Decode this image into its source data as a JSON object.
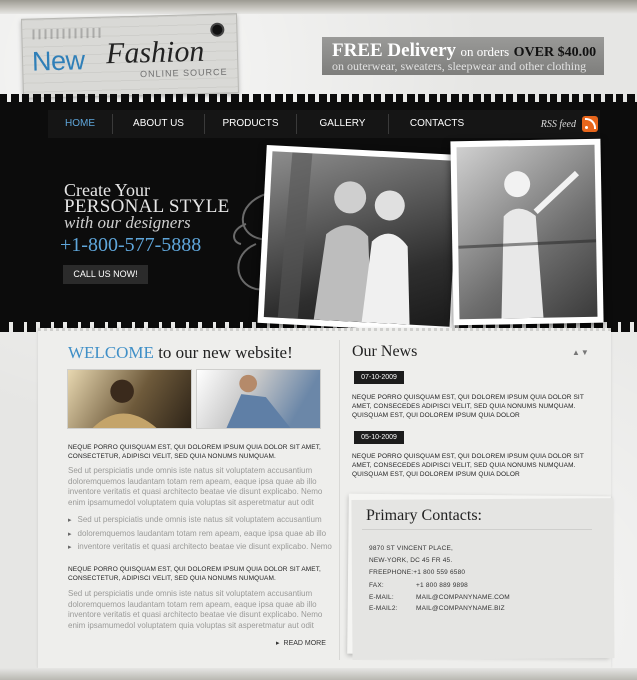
{
  "logo": {
    "word1": "New",
    "word2": "Fashion",
    "subtitle": "ONLINE SOURCE"
  },
  "delivery": {
    "free": "FREE Delivery",
    "on_orders": "on orders",
    "over": "OVER $40.00",
    "line2": "on outerwear, sweaters, sleepwear and other clothing"
  },
  "nav": {
    "items": [
      "HOME",
      "ABOUT US",
      "PRODUCTS",
      "GALLERY",
      "CONTACTS"
    ],
    "rss": "RSS feed"
  },
  "hero": {
    "line1": "Create Your",
    "line2": "PERSONAL STYLE",
    "line3": "with our designers",
    "phone": "+1-800-577-5888",
    "call_button": "CALL US NOW!"
  },
  "welcome": {
    "title_blue": "WELCOME",
    "title_rest": "to our new website!",
    "caps1": "NEQUE PORRO QUISQUAM EST, QUI DOLOREM IPSUM QUIA DOLOR SIT AMET, CONSECTETUR, ADIPISCI VELIT, SED QUIA NONUMS NUMQUAM.",
    "para1": "Sed ut perspiciatis unde omnis iste natus sit voluptatem accusantium doloremquemos laudantam totam rem apeam, eaque ipsa quae ab illo inventore veritatis et quasi architecto beatae vie disunt explicabo. Nemo enim ipsamumedol voluptatem quia voluptas sit asperetmatur aut odit",
    "bullets": [
      "Sed ut perspiciatis unde omnis iste natus sit voluptatem accusantium",
      "doloremquemos laudantam totam rem apeam, eaque ipsa quae ab illo",
      "inventore veritatis et quasi architecto beatae vie disunt explicabo. Nemo"
    ],
    "caps2": "NEQUE PORRO QUISQUAM EST, QUI DOLOREM IPSUM QUIA DOLOR SIT AMET, CONSECTETUR, ADIPISCI VELIT, SED QUIA NONUMS NUMQUAM.",
    "para2": "Sed ut perspiciatis unde omnis iste natus sit voluptatem accusantium doloremquemos laudantam totam rem apeam, eaque ipsa quae ab illo inventore veritatis et quasi architecto beatae vie disunt explicabo. Nemo enim ipsamumedol voluptatem quia voluptas sit asperetmatur aut odit",
    "read_more": "READ MORE"
  },
  "news": {
    "title": "Our News",
    "items": [
      {
        "date": "07-10-2009",
        "text": "NEQUE PORRO QUISQUAM EST, QUI DOLOREM IPSUM QUIA DOLOR SIT AMET, CONSECEDES ADIPISCI VELIT, SED QUIA NONUMS NUMQUAM. QUISQUAM EST, QUI DOLOREM IPSUM QUIA DOLOR"
      },
      {
        "date": "05-10-2009",
        "text": "NEQUE PORRO QUISQUAM EST, QUI DOLOREM IPSUM QUIA DOLOR SIT AMET, CONSECEDES ADIPISCI VELIT, SED QUIA NONUMS NUMQUAM. QUISQUAM EST, QUI DOLOREM IPSUM QUIA DOLOR"
      }
    ]
  },
  "contacts": {
    "title": "Primary Contacts:",
    "address1": "9870 ST VINCENT PLACE,",
    "address2": "NEW-YORK, DC 45 FR 45.",
    "freephone": "FREEPHONE:+1 800 559 6580",
    "fax_label": "FAX:",
    "fax": "+1 800 889 9898",
    "email_label": "E-MAIL:",
    "email": "MAIL@COMPANYNAME.COM",
    "email2_label": "E-MAIL2:",
    "email2": "MAIL@COMPANYNAME.BIZ"
  },
  "colors": {
    "accent": "#3f8fc7",
    "black": "#0c0c0c",
    "rss": "#e8661c"
  }
}
